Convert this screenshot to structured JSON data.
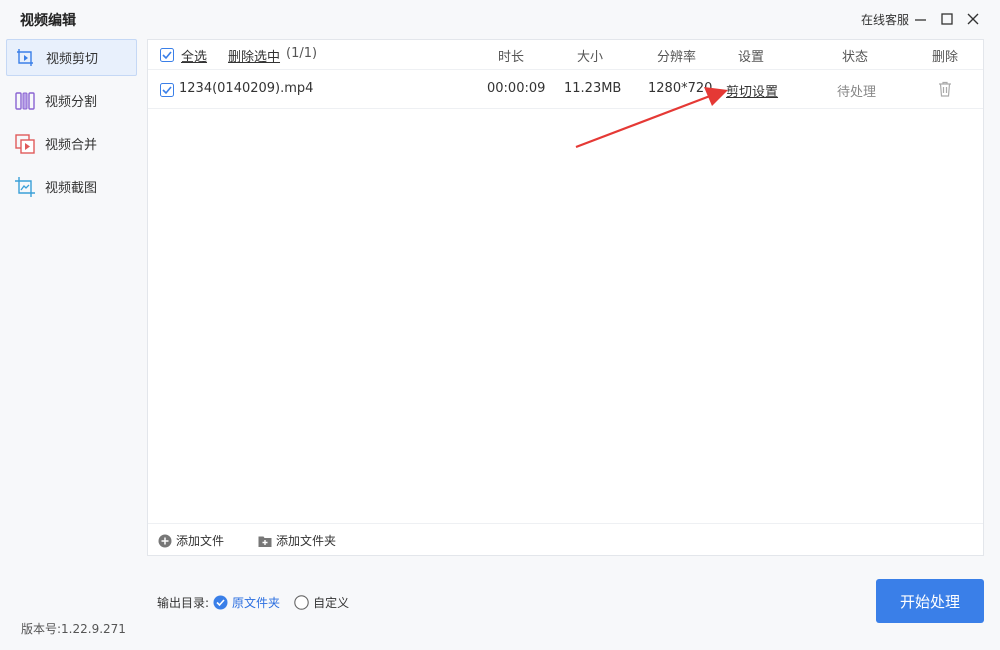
{
  "app": {
    "title": "视频编辑",
    "service": "在线客服"
  },
  "sidebar": {
    "items": [
      {
        "label": "视频剪切",
        "icon": "video-cut-icon"
      },
      {
        "label": "视频分割",
        "icon": "video-split-icon"
      },
      {
        "label": "视频合并",
        "icon": "video-merge-icon"
      },
      {
        "label": "视频截图",
        "icon": "video-screenshot-icon"
      }
    ],
    "active": 0
  },
  "version": "版本号:1.22.9.271",
  "table": {
    "select_all": "全选",
    "delete_selected": "删除选中",
    "count": "(1/1)",
    "columns": {
      "duration": "时长",
      "size": "大小",
      "resolution": "分辨率",
      "settings": "设置",
      "status": "状态",
      "delete": "删除"
    },
    "rows": [
      {
        "checked": true,
        "name": "1234(0140209).mp4",
        "duration": "00:00:09",
        "size": "11.23MB",
        "resolution": "1280*720",
        "settings": "剪切设置",
        "status": "待处理"
      }
    ]
  },
  "footer": {
    "add_file": "添加文件",
    "add_folder": "添加文件夹"
  },
  "output": {
    "label": "输出目录:",
    "option_original": "原文件夹",
    "option_custom": "自定义",
    "selected": "original"
  },
  "start_button": "开始处理",
  "colors": {
    "accent": "#3a7fe8",
    "arrow": "#e53935",
    "active_bg": "#e8f0fc"
  }
}
